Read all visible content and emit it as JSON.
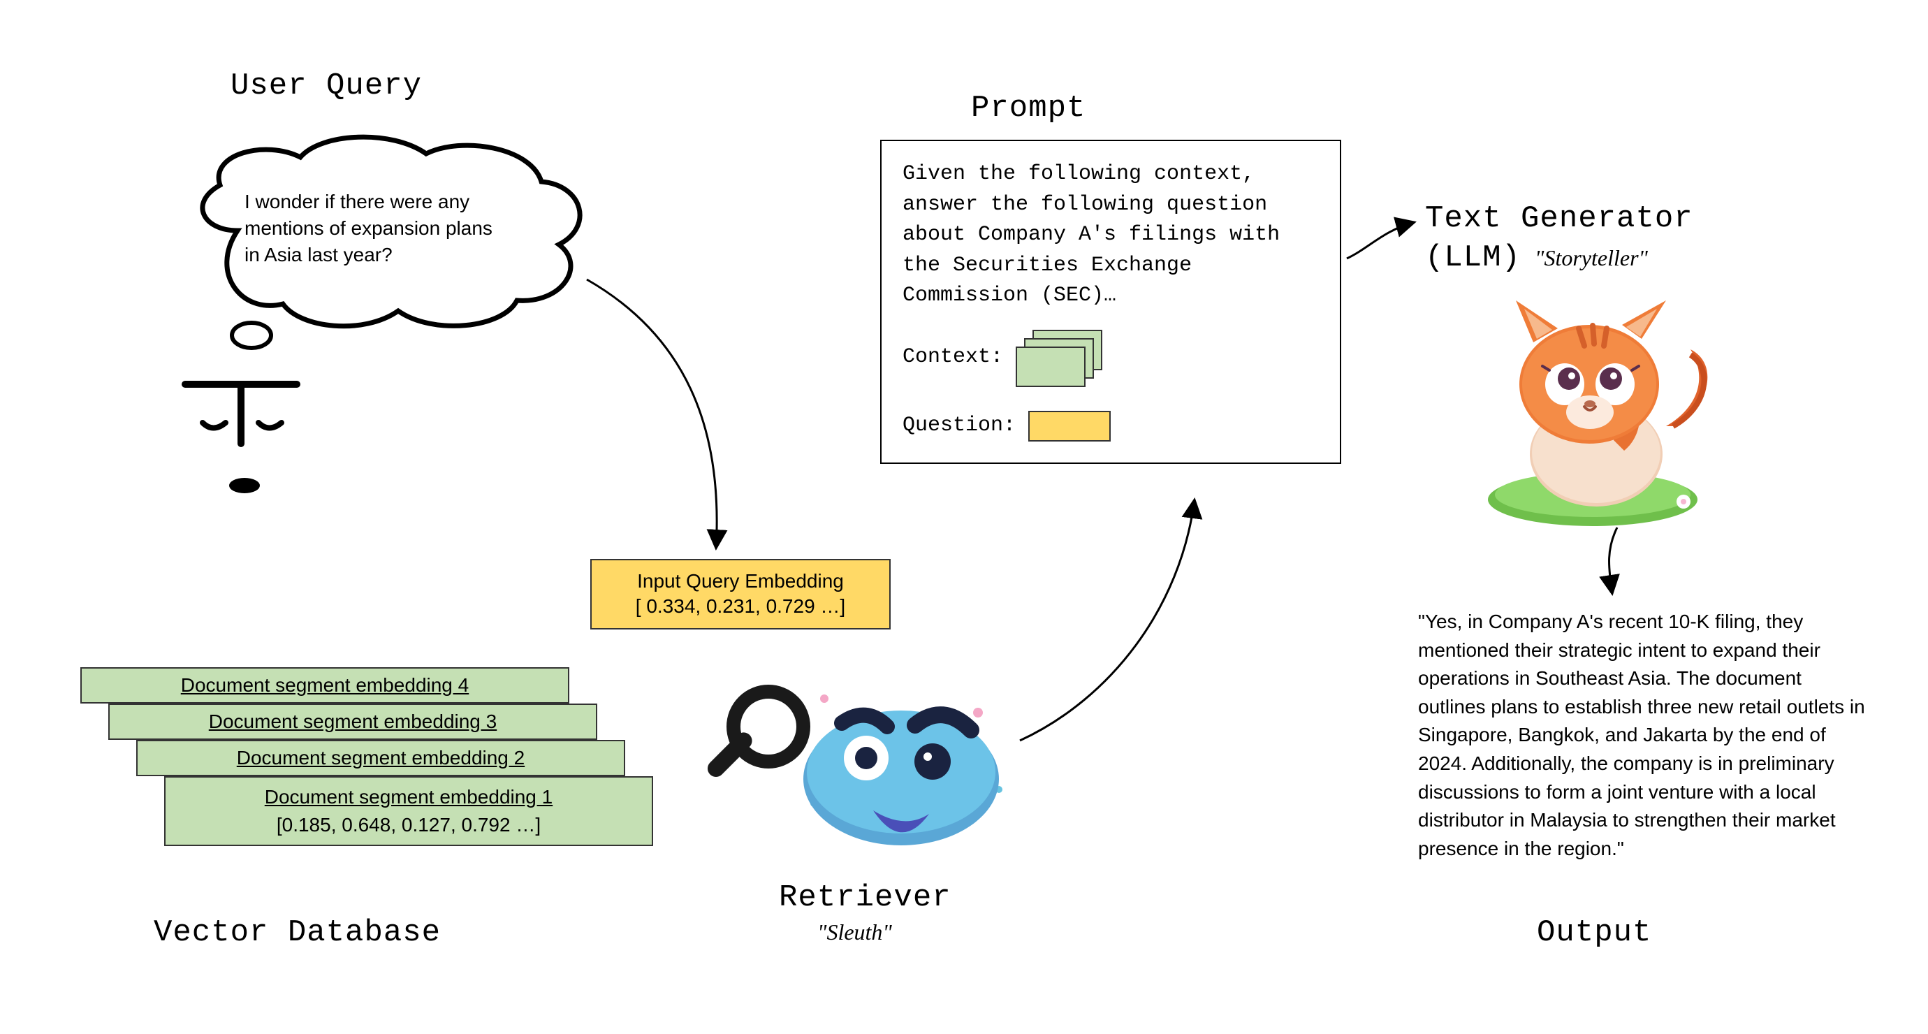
{
  "titles": {
    "user_query": "User Query",
    "prompt": "Prompt",
    "vector_database": "Vector Database",
    "retriever": "Retriever",
    "retriever_sub": "\"Sleuth\"",
    "text_generator": "Text Generator",
    "text_generator_llm": "(LLM)",
    "text_generator_sub": "\"Storyteller\"",
    "output": "Output"
  },
  "thought": {
    "text": "I wonder if there were any mentions of expansion plans in Asia last year?"
  },
  "query_embedding": {
    "label": "Input Query Embedding",
    "values": "[ 0.334, 0.231, 0.729 …]"
  },
  "documents": [
    {
      "label": "Document segment embedding 4"
    },
    {
      "label": "Document segment embedding 3"
    },
    {
      "label": "Document segment embedding 2"
    },
    {
      "label": "Document segment embedding 1",
      "values": "[0.185, 0.648, 0.127, 0.792 …]"
    }
  ],
  "prompt_box": {
    "intro": "Given the following context, answer the following question about Company A's filings with the Securities Exchange Commission (SEC)…",
    "context_label": "Context:",
    "question_label": "Question:"
  },
  "output_text": "\"Yes, in Company A's recent 10-K filing, they mentioned their strategic intent to expand their operations in Southeast Asia. The document outlines plans to establish three new retail outlets in Singapore, Bangkok, and Jakarta by the end of 2024. Additionally, the company is in preliminary discussions to form a joint venture with a local distributor in Malaysia to strengthen their market presence in the region.\""
}
